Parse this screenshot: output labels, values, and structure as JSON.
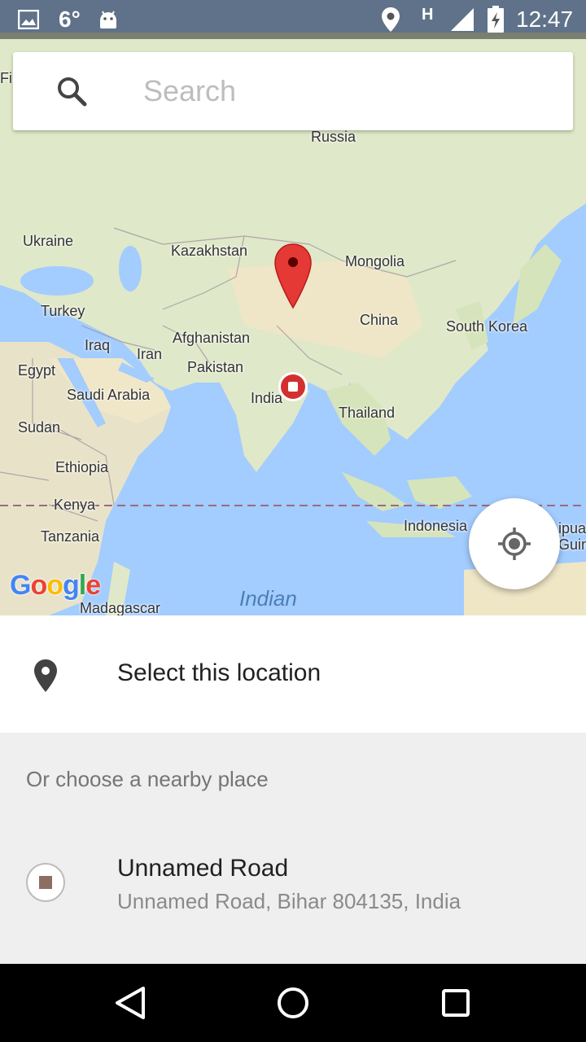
{
  "status_bar": {
    "temperature": "6°",
    "network_type": "H",
    "time": "12:47",
    "icons": [
      "gallery-icon",
      "android-icon",
      "location-icon",
      "signal-icon",
      "battery-charging-icon"
    ]
  },
  "search": {
    "placeholder": "Search",
    "value": ""
  },
  "map": {
    "labels": {
      "russia": "Russia",
      "ukraine": "Ukraine",
      "kazakhstan": "Kazakhstan",
      "mongolia": "Mongolia",
      "turkey": "Turkey",
      "china": "China",
      "south_korea": "South Korea",
      "iraq": "Iraq",
      "iran": "Iran",
      "afghanistan": "Afghanistan",
      "pakistan": "Pakistan",
      "egypt": "Egypt",
      "india": "India",
      "saudi_arabia": "Saudi Arabia",
      "thailand": "Thailand",
      "sudan": "Sudan",
      "ethiopia": "Ethiopia",
      "kenya": "Kenya",
      "tanzania": "Tanzania",
      "indonesia": "Indonesia",
      "madagascar": "Madagascar",
      "indian_ocean": "Indian",
      "papua_partial_1": "ipua",
      "papua_partial_2": "Guin",
      "fi_partial": "Fi"
    },
    "attribution": "Google",
    "colors": {
      "water": "#a3ccff",
      "land": "#e6ecd6",
      "pin": "#e53935",
      "accent_marker": "#d32f2f"
    }
  },
  "select_location": {
    "label": "Select this location"
  },
  "nearby": {
    "header": "Or choose a nearby place",
    "places": [
      {
        "name": "Unnamed Road",
        "address": "Unnamed Road, Bihar 804135, India"
      }
    ]
  }
}
